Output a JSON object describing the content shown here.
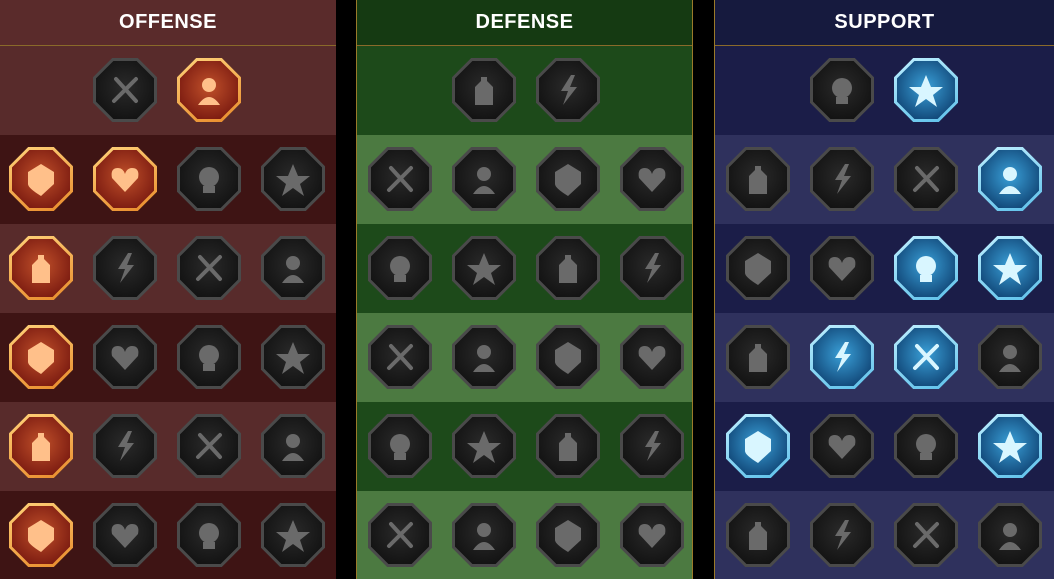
{
  "trees": {
    "offense": {
      "title": "OFFENSE",
      "accent": "#e8782a"
    },
    "defense": {
      "title": "DEFENSE",
      "accent": "#4c7a41"
    },
    "support": {
      "title": "SUPPORT",
      "accent": "#5cc0ea"
    }
  },
  "nodes": {
    "offense": [
      [
        "crossed-swords-icon",
        "dagger-slash-icon"
      ],
      [
        "demon-icon",
        "red-slashes-icon",
        "shield-arrow-icon",
        "bleeding-heart-icon"
      ],
      [
        "arrows-wound-icon",
        "fanged-mouth-icon",
        "skull-rush-icon",
        "hand-blade-icon"
      ],
      [
        "blood-sword-icon",
        "fist-icon",
        "axe-icon",
        "chain-lightning-icon"
      ],
      [
        "arrow-impact-icon",
        "skull-cluster-icon",
        "sword-ring-icon",
        "spiked-warrior-icon"
      ],
      [
        "sword-sparkle-icon",
        "helmet-icon",
        "horned-beast-icon",
        "spiked-skull-icon"
      ]
    ],
    "defense": [
      [
        "armor-plates-icon",
        "raised-fist-icon"
      ],
      [
        "chevron-shield-icon",
        "heart-organ-icon",
        "stone-golem-icon",
        "blade-guard-icon"
      ],
      [
        "tangled-figure-icon",
        "knight-shield-icon",
        "heart-fist-icon",
        "hooded-face-icon"
      ],
      [
        "crowd-icon",
        "hourglass-burst-icon",
        "open-hand-icon",
        "bull-icon"
      ],
      [
        "dash-runner-icon",
        "flame-claws-icon",
        "radiant-skull-icon",
        "slash-circle-icon"
      ],
      [
        "armored-beast-icon",
        "winged-shield-icon",
        "skull-beam-icon",
        "muscle-figure-icon"
      ]
    ],
    "support": [
      [
        "heart-plus-icon",
        "spiral-hand-icon"
      ],
      [
        "praying-hands-icon",
        "arched-shield-icon",
        "smoking-skull-icon",
        "winged-boot-icon"
      ],
      [
        "sparkle-figure-icon",
        "lightning-frame-icon",
        "broken-ground-icon",
        "shadow-figures-icon"
      ],
      [
        "chained-heart-icon",
        "fire-comet-icon",
        "open-book-icon",
        "angry-face-icon"
      ],
      [
        "compass-star-icon",
        "running-legs-icon",
        "eye-icon",
        "leaping-figure-icon"
      ],
      [
        "potion-icon",
        "winged-skull-icon",
        "grasping-hand-icon",
        "eagle-icon"
      ]
    ]
  },
  "active": {
    "offense": [
      [
        1
      ],
      [
        0,
        1
      ],
      [
        0
      ],
      [
        0
      ],
      [
        0
      ],
      [
        0
      ]
    ],
    "defense": [
      [],
      [],
      [],
      [],
      [],
      []
    ],
    "support": [
      [
        1
      ],
      [
        3
      ],
      [
        2,
        3
      ],
      [
        1,
        2
      ],
      [
        0,
        3
      ],
      []
    ]
  }
}
